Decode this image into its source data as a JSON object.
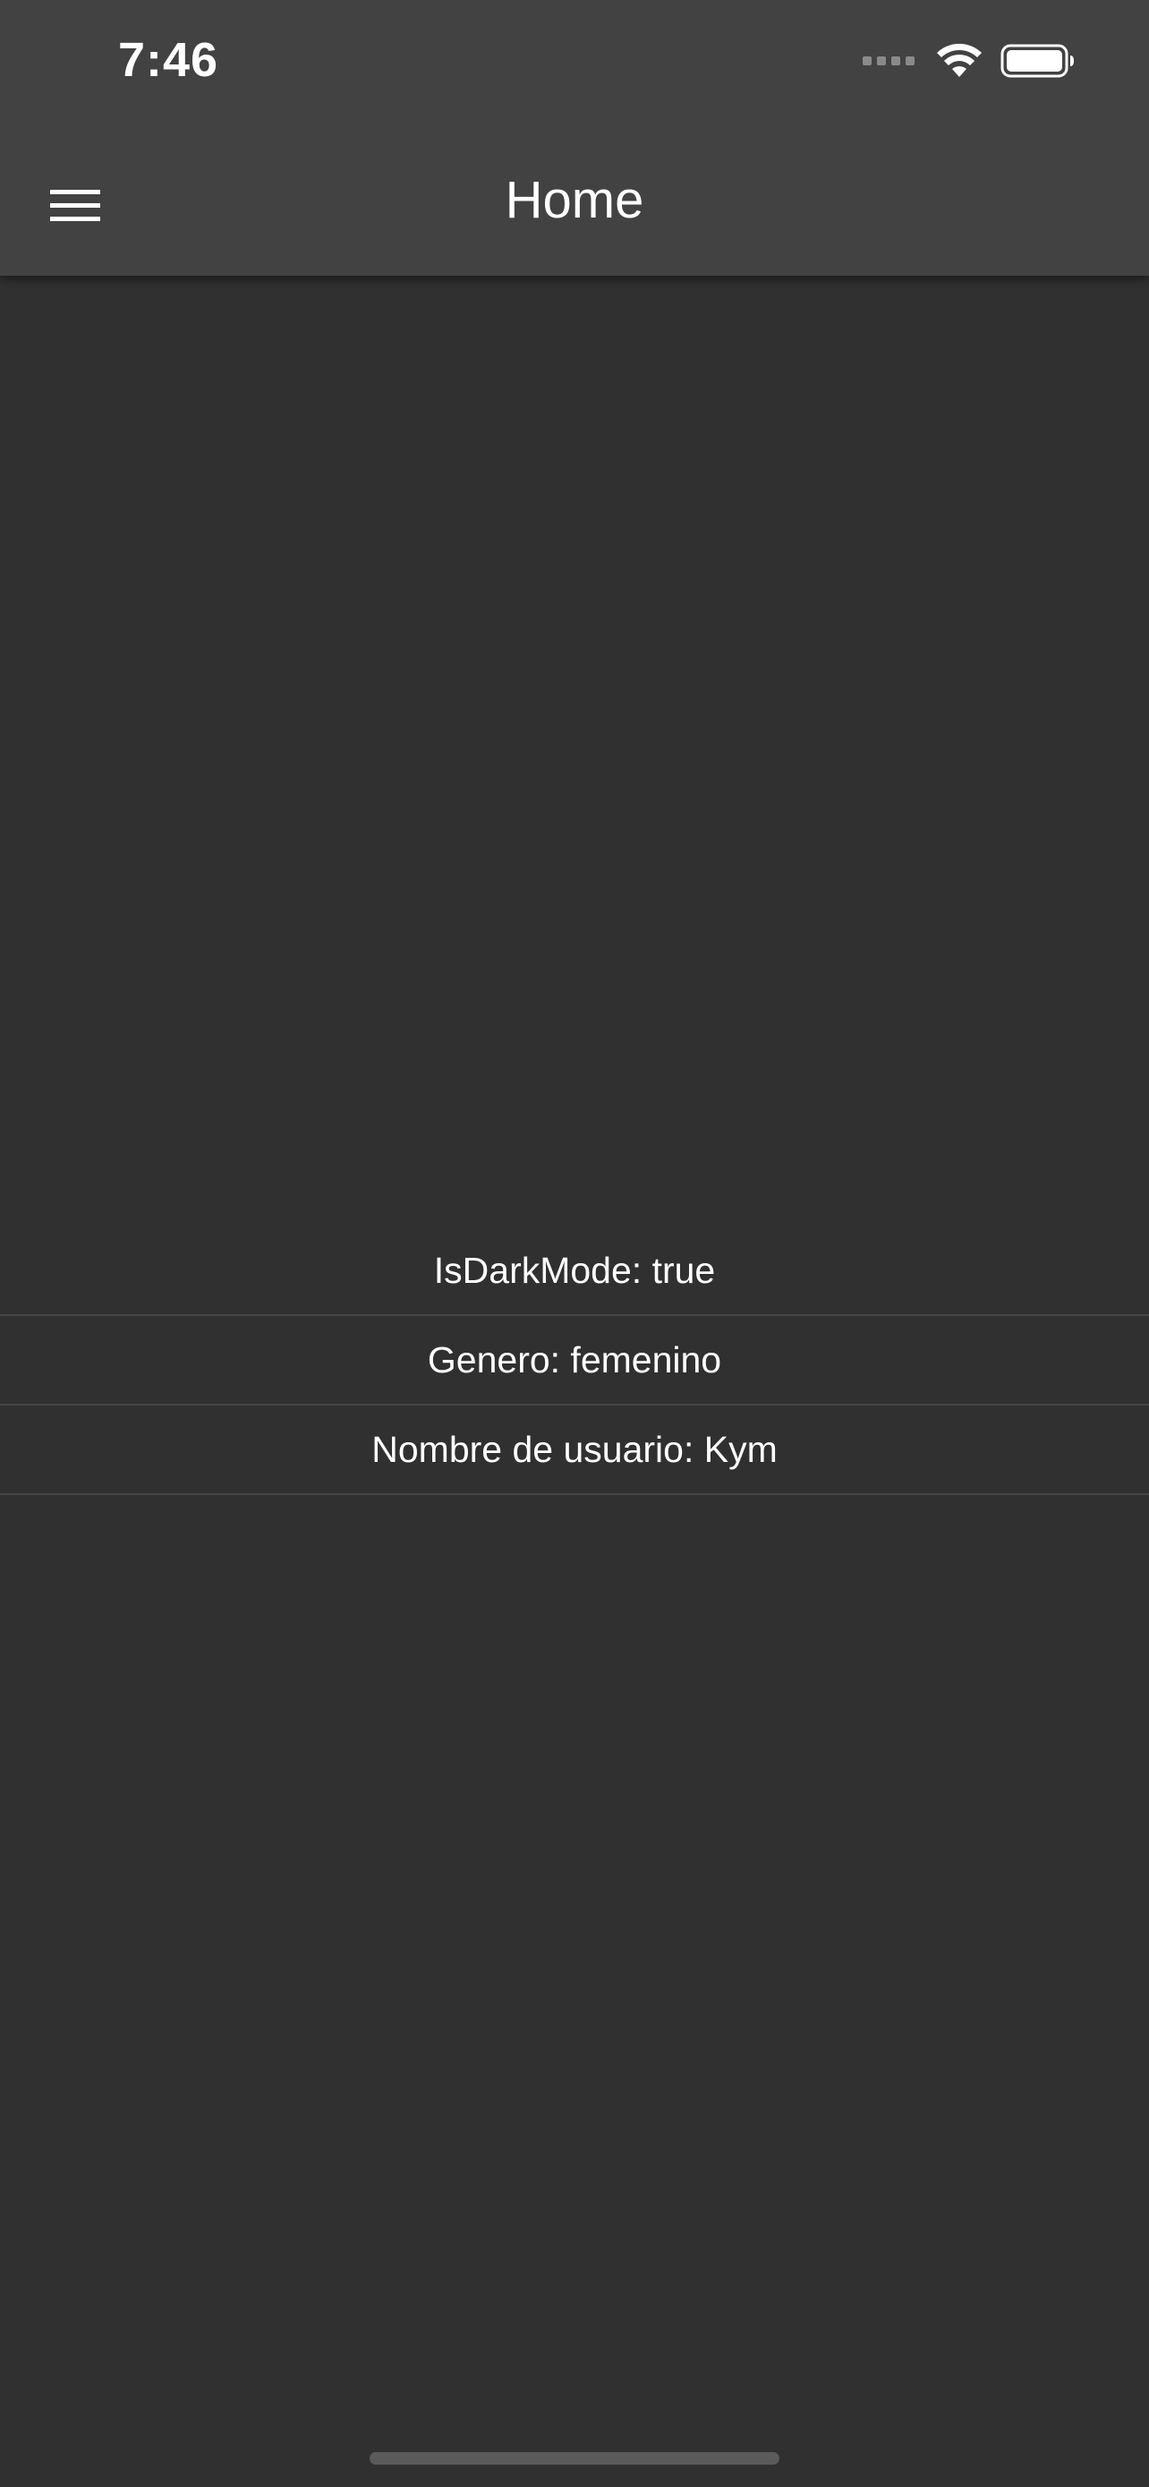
{
  "status_bar": {
    "time": "7:46",
    "icons": [
      "signal-dots-icon",
      "wifi-icon",
      "battery-icon"
    ]
  },
  "app_bar": {
    "title": "Home",
    "menu_icon": "hamburger-menu-icon"
  },
  "list": {
    "items": [
      {
        "text": "IsDarkMode: true"
      },
      {
        "text": "Genero: femenino"
      },
      {
        "text": "Nombre de usuario: Kym"
      }
    ]
  },
  "colors": {
    "background": "#303030",
    "app_bar": "#424242",
    "text": "#ffffff",
    "divider": "#464646"
  }
}
